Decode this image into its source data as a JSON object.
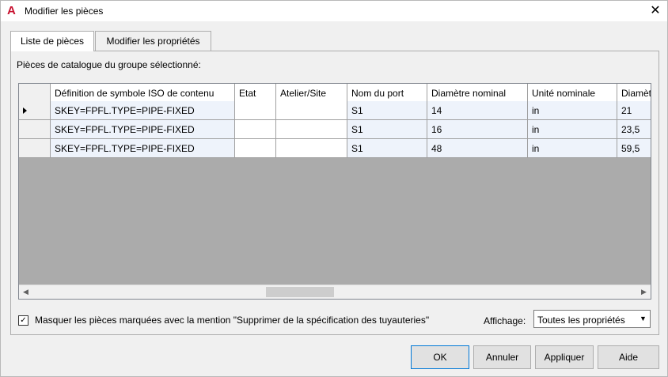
{
  "window": {
    "title": "Modifier les pièces",
    "app_icon": "autocad-a-icon",
    "close_glyph": "✕"
  },
  "tabs": [
    {
      "label": "Liste de pièces",
      "active": true
    },
    {
      "label": "Modifier les propriétés",
      "active": false
    }
  ],
  "group_label": "Pièces de catalogue du groupe sélectionné:",
  "grid": {
    "columns": [
      "Définition de symbole ISO de contenu",
      "Etat",
      "Atelier/Site",
      "Nom du port",
      "Diamètre nominal",
      "Unité nominale",
      "Diamèt"
    ],
    "rows": [
      {
        "current": true,
        "cells": [
          "SKEY=FPFL.TYPE=PIPE-FIXED",
          "",
          "",
          "S1",
          "14",
          "in",
          "21"
        ]
      },
      {
        "current": false,
        "cells": [
          "SKEY=FPFL.TYPE=PIPE-FIXED",
          "",
          "",
          "S1",
          "16",
          "in",
          "23,5"
        ]
      },
      {
        "current": false,
        "cells": [
          "SKEY=FPFL.TYPE=PIPE-FIXED",
          "",
          "",
          "S1",
          "48",
          "in",
          "59,5"
        ]
      }
    ]
  },
  "hide_checkbox": {
    "checked": true,
    "label": "Masquer les pièces marquées avec la mention \"Supprimer de la spécification des tuyauteries\""
  },
  "display": {
    "label": "Affichage:",
    "value": "Toutes les propriétés"
  },
  "buttons": {
    "ok": "OK",
    "cancel": "Annuler",
    "apply": "Appliquer",
    "help": "Aide"
  },
  "colors": {
    "grid_empty_bg": "#ababab",
    "readonly_cell_bg": "#eef3fb",
    "default_button_border": "#0078d7",
    "app_icon_red": "#c8102e"
  }
}
